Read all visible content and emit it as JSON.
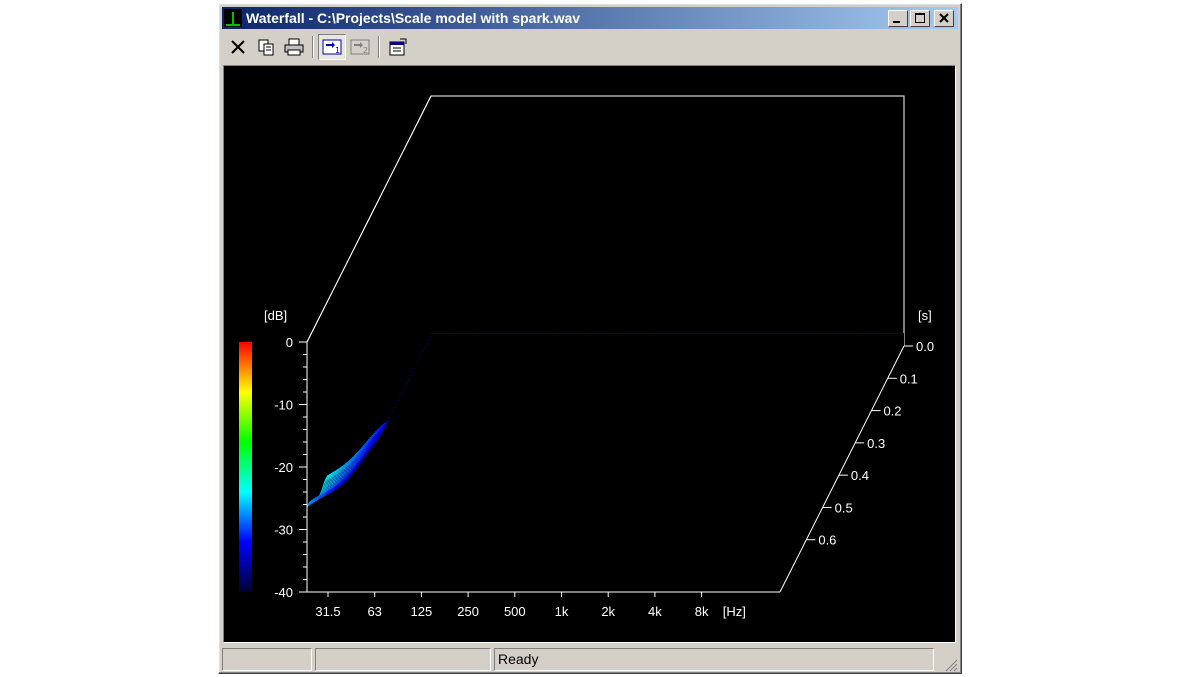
{
  "window": {
    "title": "Waterfall - C:\\Projects\\Scale model with spark.wav",
    "minimize": "_",
    "maximize": "□",
    "close": "×"
  },
  "toolbar": {
    "buttons": [
      {
        "name": "close-x-icon"
      },
      {
        "name": "copy-icon"
      },
      {
        "name": "print-icon"
      },
      {
        "name": "view-mode-1-icon",
        "pressed": true
      },
      {
        "name": "view-mode-2-icon",
        "pressed": false
      },
      {
        "name": "properties-icon"
      }
    ]
  },
  "chart": {
    "z_unit": "[dB]",
    "z_ticks": [
      "0",
      "-10",
      "-20",
      "-30",
      "-40"
    ],
    "x_unit": "[Hz]",
    "x_ticks": [
      "31.5",
      "63",
      "125",
      "250",
      "500",
      "1k",
      "2k",
      "4k",
      "8k"
    ],
    "t_unit": "[s]",
    "t_ticks": [
      "0.0",
      "0.1",
      "0.2",
      "0.3",
      "0.4",
      "0.5",
      "0.6"
    ],
    "colors": {
      "background": "#000000",
      "axis": "#ffffff"
    }
  },
  "chart_data": {
    "type": "area",
    "subtype": "waterfall-3d",
    "x_scale": "log",
    "xlim_label": [
      "31.5",
      "8k"
    ],
    "zlim": [
      -40,
      0
    ],
    "tlim": [
      0.0,
      0.65
    ],
    "colormap": [
      "#000033",
      "#0000ff",
      "#00ffff",
      "#00ff00",
      "#ffff00",
      "#ff0000"
    ]
  },
  "statusbar": {
    "pane1": "",
    "pane2": "",
    "status_text": "Ready"
  }
}
